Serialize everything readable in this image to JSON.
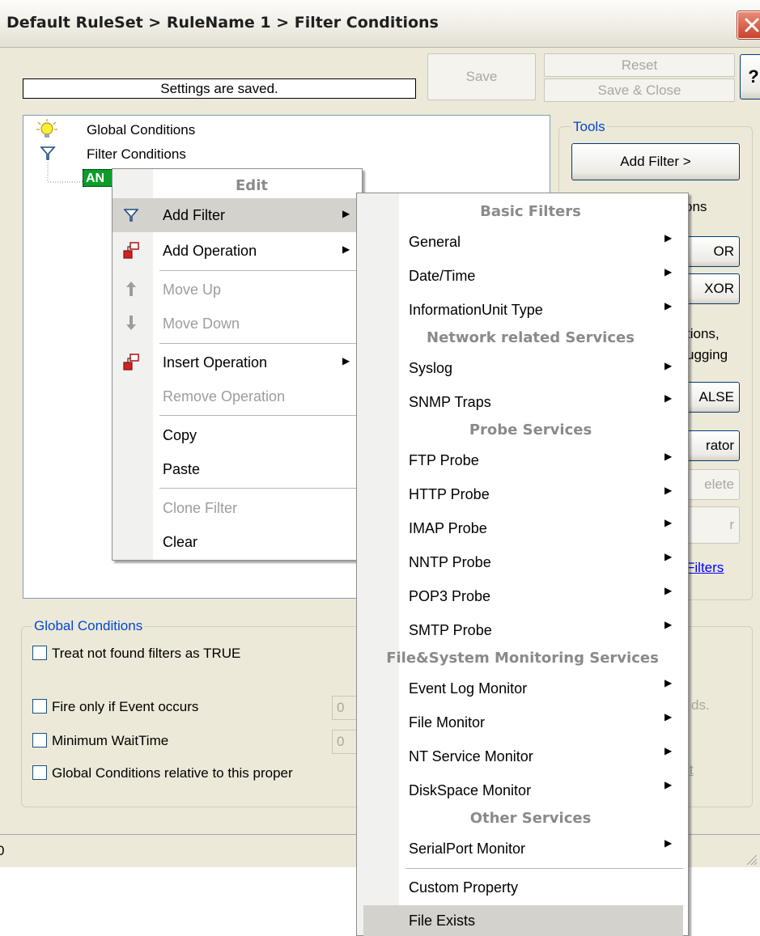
{
  "window": {
    "title": "Default RuleSet > RuleName 1 > Filter Conditions"
  },
  "toolbar": {
    "status": "Settings are saved.",
    "save_label": "Save",
    "reset_label": "Reset",
    "save_close_label": "Save & Close",
    "help_label": "?"
  },
  "tree": {
    "global_conditions": "Global Conditions",
    "filter_conditions": "Filter Conditions",
    "and_node": "AN"
  },
  "tools": {
    "title": "Tools",
    "add_filter_label": "Add Filter >",
    "operations_partial": "ons",
    "or_label": "OR",
    "xor_label": "XOR",
    "hint_line1": "tions,",
    "hint_line2": "ugging",
    "false_label": "ALSE",
    "operator_label": "rator",
    "delete_label": "elete",
    "filter_btn_partial": "r",
    "filters_link": "Filters"
  },
  "global_conditions": {
    "title": "Global Conditions",
    "treat_not_found": "Treat not found filters as TRUE",
    "fire_only_if": "Fire only if Event occurs",
    "fire_value": "0",
    "min_waittime": "Minimum WaitTime",
    "min_value": "0",
    "relative_to": "Global Conditions relative to this proper",
    "right_partial_1": "ds.",
    "right_partial_2": "t"
  },
  "statusbar": {
    "left_text": "0"
  },
  "edit_menu": {
    "header": "Edit",
    "items": [
      {
        "label": "Add Filter",
        "icon": "filter-icon",
        "submenu": true,
        "enabled": true
      },
      {
        "label": "Add Operation",
        "icon": "operation-icon",
        "submenu": true,
        "enabled": true
      },
      {
        "label": "Move Up",
        "icon": "arrow-up-icon",
        "submenu": false,
        "enabled": false
      },
      {
        "label": "Move Down",
        "icon": "arrow-down-icon",
        "submenu": false,
        "enabled": false
      },
      {
        "label": "Insert Operation",
        "icon": "operation-icon",
        "submenu": true,
        "enabled": true
      },
      {
        "label": "Remove Operation",
        "submenu": false,
        "enabled": false
      },
      {
        "label": "Copy",
        "submenu": false,
        "enabled": true
      },
      {
        "label": "Paste",
        "submenu": false,
        "enabled": true
      },
      {
        "label": "Clone Filter",
        "submenu": false,
        "enabled": false
      },
      {
        "label": "Clear",
        "submenu": false,
        "enabled": true
      }
    ]
  },
  "filter_menu": {
    "sections": [
      {
        "header": "Basic Filters",
        "items": [
          "General",
          "Date/Time",
          "InformationUnit Type"
        ]
      },
      {
        "header": "Network related Services",
        "items": [
          "Syslog",
          "SNMP Traps"
        ]
      },
      {
        "header": "Probe Services",
        "items": [
          "FTP Probe",
          "HTTP Probe",
          "IMAP Probe",
          "NNTP Probe",
          "POP3 Probe",
          "SMTP Probe"
        ]
      },
      {
        "header": "File&System Monitoring Services",
        "items": [
          "Event Log Monitor",
          "File Monitor",
          "NT Service Monitor",
          "DiskSpace Monitor"
        ]
      },
      {
        "header": "Other Services",
        "items": [
          "SerialPort Monitor"
        ]
      }
    ],
    "custom_property": "Custom Property",
    "file_exists": "File Exists",
    "highlighted": "File Exists"
  },
  "colors": {
    "window_bg": "#ece9d8",
    "and_node_bg": "#0a9d2a",
    "group_title": "#0046d5",
    "close_button": "#c8432b",
    "menu_highlight": "#d4d2cc"
  }
}
